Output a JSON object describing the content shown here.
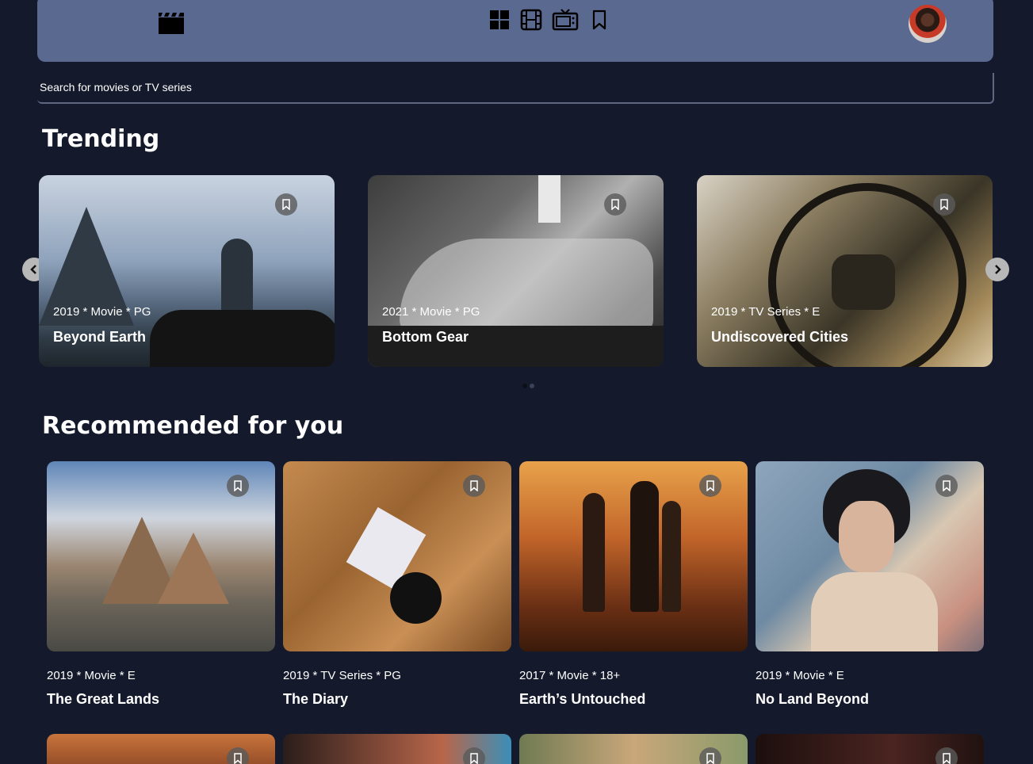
{
  "nav": {
    "logo_icon": "film-clapper-icon",
    "icons": [
      "grid-icon",
      "film-icon",
      "tv-icon",
      "bookmark-icon"
    ],
    "avatar": "user-avatar"
  },
  "search": {
    "placeholder": "Search for movies or TV series"
  },
  "trending": {
    "title": "Trending",
    "items": [
      {
        "meta": "2019 * Movie * PG",
        "title": "Beyond Earth"
      },
      {
        "meta": "2021 * Movie * PG",
        "title": "Bottom Gear"
      },
      {
        "meta": "2019 * TV Series * E",
        "title": "Undiscovered Cities"
      }
    ]
  },
  "recommended": {
    "title": "Recommended for you",
    "items": [
      {
        "meta": "2019 * Movie * E",
        "title": "The Great Lands"
      },
      {
        "meta": "2019 * TV Series * PG",
        "title": "The Diary"
      },
      {
        "meta": "2017 * Movie * 18+",
        "title": "Earth’s Untouched"
      },
      {
        "meta": "2019 * Movie * E",
        "title": "No Land Beyond"
      }
    ]
  },
  "colors": {
    "background": "#141a2c",
    "navbar": "#5a698f",
    "text": "#ffffff"
  }
}
